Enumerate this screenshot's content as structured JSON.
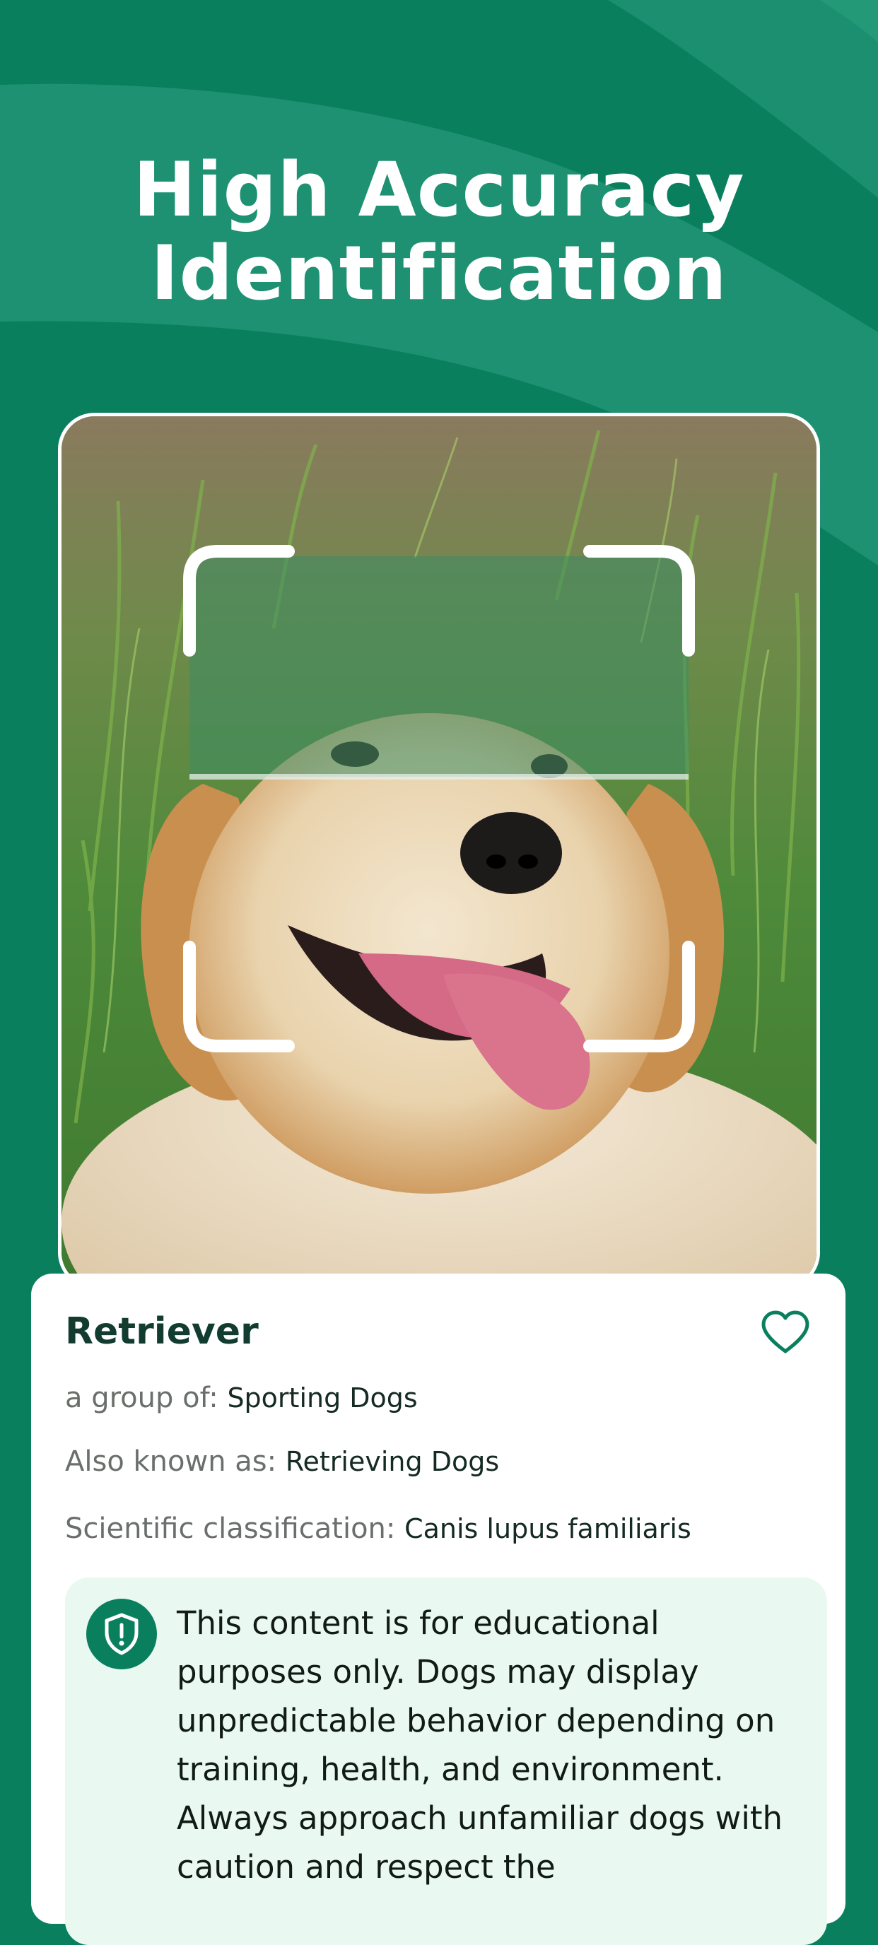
{
  "headline": {
    "line1": "High Accuracy",
    "line2": "Identification"
  },
  "colors": {
    "background": "#0a7f5e",
    "background_swoosh": "#1f9373",
    "card": "#ffffff",
    "notice_bg": "#e9f9f1",
    "accent": "#0a7f5e",
    "title_text": "#123c2f"
  },
  "photo": {
    "subject": "golden retriever dog lying in grass",
    "scan_frame_icon": "scan-brackets-icon"
  },
  "result_card": {
    "breed_name": "Retriever",
    "favorite_icon": "heart-outline-icon",
    "group_label": "a group of:",
    "group_value": "Sporting Dogs",
    "aka_label": "Also known as:",
    "aka_value": "Retrieving Dogs",
    "classification_label": "Scientific classification:",
    "classification_value": "Canis lupus familiaris",
    "notice_icon": "shield-exclamation-icon",
    "notice_text": "This content is for educational purposes only. Dogs may display unpredictable behavior depending on training, health, and environment. Always approach unfamiliar dogs with caution and respect the"
  }
}
